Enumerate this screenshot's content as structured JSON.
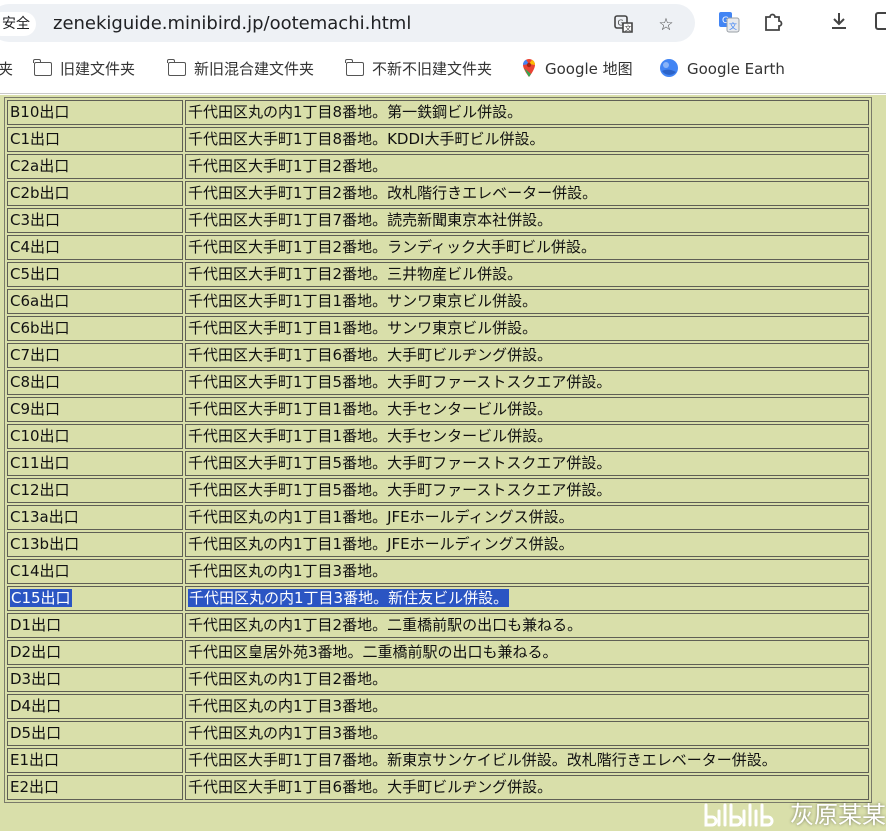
{
  "address_bar": {
    "security_label": "安全",
    "url": "zenekiguide.minibird.jp/ootemachi.html"
  },
  "bookmarks": [
    {
      "label": "旧建文件夹",
      "icon": "folder-icon"
    },
    {
      "label": "新旧混合建文件夹",
      "icon": "folder-icon"
    },
    {
      "label": "不新不旧建文件夹",
      "icon": "folder-icon"
    },
    {
      "label": "Google 地图",
      "icon": "google-maps-icon"
    },
    {
      "label": "Google Earth",
      "icon": "google-earth-icon"
    }
  ],
  "bookmark_cut_label": "夹",
  "exits": [
    {
      "exit": "B10出口",
      "desc": "千代田区丸の内1丁目8番地。第一鉄鋼ビル併設。"
    },
    {
      "exit": "C1出口",
      "desc": "千代田区大手町1丁目8番地。KDDI大手町ビル併設。"
    },
    {
      "exit": "C2a出口",
      "desc": "千代田区大手町1丁目2番地。"
    },
    {
      "exit": "C2b出口",
      "desc": "千代田区大手町1丁目2番地。改札階行きエレベーター併設。"
    },
    {
      "exit": "C3出口",
      "desc": "千代田区大手町1丁目7番地。読売新聞東京本社併設。"
    },
    {
      "exit": "C4出口",
      "desc": "千代田区大手町1丁目2番地。ランディック大手町ビル併設。"
    },
    {
      "exit": "C5出口",
      "desc": "千代田区大手町1丁目2番地。三井物産ビル併設。"
    },
    {
      "exit": "C6a出口",
      "desc": "千代田区大手町1丁目1番地。サンワ東京ビル併設。"
    },
    {
      "exit": "C6b出口",
      "desc": "千代田区大手町1丁目1番地。サンワ東京ビル併設。"
    },
    {
      "exit": "C7出口",
      "desc": "千代田区大手町1丁目6番地。大手町ビルヂング併設。"
    },
    {
      "exit": "C8出口",
      "desc": "千代田区大手町1丁目5番地。大手町ファーストスクエア併設。"
    },
    {
      "exit": "C9出口",
      "desc": "千代田区大手町1丁目1番地。大手センタービル併設。"
    },
    {
      "exit": "C10出口",
      "desc": "千代田区大手町1丁目1番地。大手センタービル併設。"
    },
    {
      "exit": "C11出口",
      "desc": "千代田区大手町1丁目5番地。大手町ファーストスクエア併設。"
    },
    {
      "exit": "C12出口",
      "desc": "千代田区大手町1丁目5番地。大手町ファーストスクエア併設。"
    },
    {
      "exit": "C13a出口",
      "desc": "千代田区丸の内1丁目1番地。JFEホールディングス併設。"
    },
    {
      "exit": "C13b出口",
      "desc": "千代田区丸の内1丁目1番地。JFEホールディングス併設。"
    },
    {
      "exit": "C14出口",
      "desc": "千代田区丸の内1丁目3番地。"
    },
    {
      "exit": "C15出口",
      "desc": "千代田区丸の内1丁目3番地。新住友ビル併設。",
      "selected": true
    },
    {
      "exit": "D1出口",
      "desc": "千代田区丸の内1丁目2番地。二重橋前駅の出口も兼ねる。"
    },
    {
      "exit": "D2出口",
      "desc": "千代田区皇居外苑3番地。二重橋前駅の出口も兼ねる。"
    },
    {
      "exit": "D3出口",
      "desc": "千代田区丸の内1丁目2番地。"
    },
    {
      "exit": "D4出口",
      "desc": "千代田区丸の内1丁目3番地。"
    },
    {
      "exit": "D5出口",
      "desc": "千代田区丸の内1丁目3番地。"
    },
    {
      "exit": "E1出口",
      "desc": "千代田区大手町1丁目7番地。新東京サンケイビル併設。改札階行きエレベーター併設。"
    },
    {
      "exit": "E2出口",
      "desc": "千代田区大手町1丁目6番地。大手町ビルヂング併設。"
    }
  ],
  "watermark": {
    "text": "灰原某某",
    "logo": "bilibili-logo"
  },
  "colors": {
    "page_bg": "#d9dfaa",
    "selection": "#2b55c3"
  }
}
